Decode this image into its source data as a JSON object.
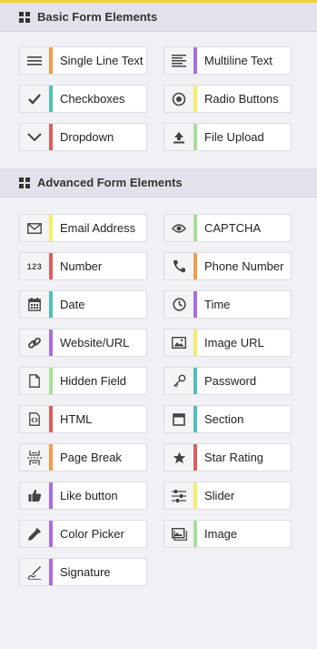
{
  "colors": {
    "orange": "#f79a4a",
    "purple": "#a86fe0",
    "teal": "#4fc1bc",
    "yellow": "#f6ee6a",
    "red": "#e05d5d",
    "green": "#a9dd9a"
  },
  "sections": {
    "basic": {
      "title": "Basic Form Elements",
      "items": [
        {
          "label": "Single Line Text",
          "icon": "lines-icon",
          "color": "orange"
        },
        {
          "label": "Multiline Text",
          "icon": "paragraph-icon",
          "color": "purple"
        },
        {
          "label": "Checkboxes",
          "icon": "check-icon",
          "color": "teal"
        },
        {
          "label": "Radio Buttons",
          "icon": "radio-icon",
          "color": "yellow"
        },
        {
          "label": "Dropdown",
          "icon": "chevron-down-icon",
          "color": "red"
        },
        {
          "label": "File Upload",
          "icon": "upload-icon",
          "color": "green"
        }
      ]
    },
    "advanced": {
      "title": "Advanced Form Elements",
      "items": [
        {
          "label": "Email Address",
          "icon": "envelope-icon",
          "color": "yellow"
        },
        {
          "label": "CAPTCHA",
          "icon": "eye-icon",
          "color": "green"
        },
        {
          "label": "Number",
          "icon": "number-icon",
          "icon_text": "123",
          "color": "red"
        },
        {
          "label": "Phone Number",
          "icon": "phone-icon",
          "color": "orange"
        },
        {
          "label": "Date",
          "icon": "calendar-icon",
          "color": "teal"
        },
        {
          "label": "Time",
          "icon": "clock-icon",
          "color": "purple"
        },
        {
          "label": "Website/URL",
          "icon": "link-icon",
          "color": "purple"
        },
        {
          "label": "Image URL",
          "icon": "image-url-icon",
          "color": "yellow"
        },
        {
          "label": "Hidden Field",
          "icon": "document-icon",
          "color": "green"
        },
        {
          "label": "Password",
          "icon": "key-icon",
          "color": "teal"
        },
        {
          "label": "HTML",
          "icon": "code-file-icon",
          "color": "red"
        },
        {
          "label": "Section",
          "icon": "section-icon",
          "color": "teal"
        },
        {
          "label": "Page Break",
          "icon": "page-break-icon",
          "color": "orange"
        },
        {
          "label": "Star Rating",
          "icon": "star-icon",
          "color": "red"
        },
        {
          "label": "Like button",
          "icon": "thumbs-up-icon",
          "color": "purple"
        },
        {
          "label": "Slider",
          "icon": "slider-icon",
          "color": "yellow"
        },
        {
          "label": "Color Picker",
          "icon": "eyedropper-icon",
          "color": "purple"
        },
        {
          "label": "Image",
          "icon": "image-icon",
          "color": "green"
        },
        {
          "label": "Signature",
          "icon": "pen-icon",
          "color": "purple"
        }
      ]
    }
  }
}
